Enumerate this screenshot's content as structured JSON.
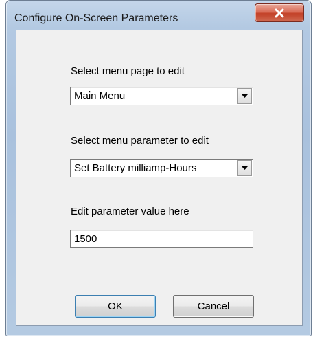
{
  "window": {
    "title": "Configure On-Screen Parameters",
    "close_icon": "close-x-icon"
  },
  "menu_page": {
    "label": "Select menu page to edit",
    "selected": "Main Menu",
    "arrow_icon": "chevron-down-icon"
  },
  "menu_parameter": {
    "label": "Select menu parameter to edit",
    "selected": "Set Battery milliamp-Hours",
    "arrow_icon": "chevron-down-icon"
  },
  "parameter_value": {
    "label": "Edit parameter value here",
    "value": "1500"
  },
  "buttons": {
    "ok_label": "OK",
    "cancel_label": "Cancel"
  }
}
